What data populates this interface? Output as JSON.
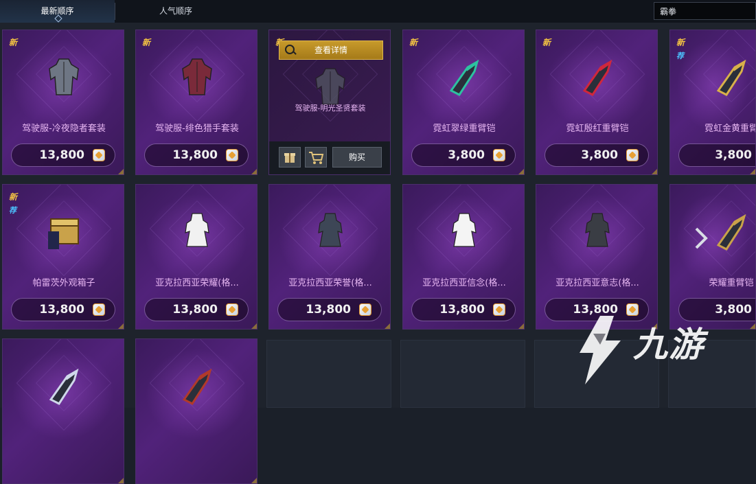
{
  "tabs": [
    {
      "label": "最新顺序",
      "active": true
    },
    {
      "label": "人气顺序",
      "active": false
    }
  ],
  "search": {
    "value": "霸拳"
  },
  "hover_actions": {
    "detail_label": "查看详情",
    "buy_label": "购买",
    "gift_icon": "gift-icon",
    "cart_icon": "cart-icon"
  },
  "items": [
    {
      "name": "驾驶服-冷夜隐者套装",
      "price": "13,800",
      "new": "新",
      "rec": "",
      "icon": "armor-suit-icon",
      "color": "#6e7684"
    },
    {
      "name": "驾驶服-绯色猎手套装",
      "price": "13,800",
      "new": "新",
      "rec": "",
      "icon": "armor-suit-icon",
      "color": "#7a2a3a"
    },
    {
      "name": "驾驶服-明光圣贤套装",
      "price": "",
      "new": "新",
      "rec": "",
      "icon": "armor-suit-icon",
      "color": "#555b64"
    },
    {
      "name": "霓虹翠绿重臂铠",
      "price": "3,800",
      "new": "新",
      "rec": "",
      "icon": "gauntlet-icon",
      "color": "#2dc2a0"
    },
    {
      "name": "霓虹殷红重臂铠",
      "price": "3,800",
      "new": "新",
      "rec": "",
      "icon": "gauntlet-icon",
      "color": "#d0273b"
    },
    {
      "name": "霓虹金黄重臂",
      "price": "3,800",
      "new": "新",
      "rec": "荐",
      "icon": "gauntlet-icon",
      "color": "#d8b04a"
    },
    {
      "name": "帕雷茨外观箱子",
      "price": "13,800",
      "new": "新",
      "rec": "荐",
      "icon": "chest-icon",
      "color": "#c9a24a"
    },
    {
      "name": "亚克拉西亚荣耀(格...",
      "price": "13,800",
      "new": "",
      "rec": "",
      "icon": "dress-icon",
      "color": "#f1f1f1"
    },
    {
      "name": "亚克拉西亚荣誉(格...",
      "price": "13,800",
      "new": "",
      "rec": "",
      "icon": "dress-icon",
      "color": "#3d4656"
    },
    {
      "name": "亚克拉西亚信念(格...",
      "price": "13,800",
      "new": "",
      "rec": "",
      "icon": "dress-icon",
      "color": "#f4f4f4"
    },
    {
      "name": "亚克拉西亚意志(格...",
      "price": "13,800",
      "new": "",
      "rec": "",
      "icon": "dress-icon",
      "color": "#3a3d44"
    },
    {
      "name": "荣耀重臂铠",
      "price": "3,800",
      "new": "",
      "rec": "",
      "icon": "gauntlet-icon",
      "color": "#c9a24a"
    },
    {
      "name": "",
      "price": "",
      "new": "",
      "rec": "",
      "icon": "claw-gauntlet-icon",
      "color": "#cfd7ea"
    },
    {
      "name": "",
      "price": "",
      "new": "",
      "rec": "",
      "icon": "claw-gauntlet-icon",
      "color": "#b13a2a"
    }
  ],
  "watermark": {
    "text": "九游",
    "icon": "jiuyou-logo-icon"
  },
  "nav": {
    "next_icon": "chevron-right-icon"
  }
}
